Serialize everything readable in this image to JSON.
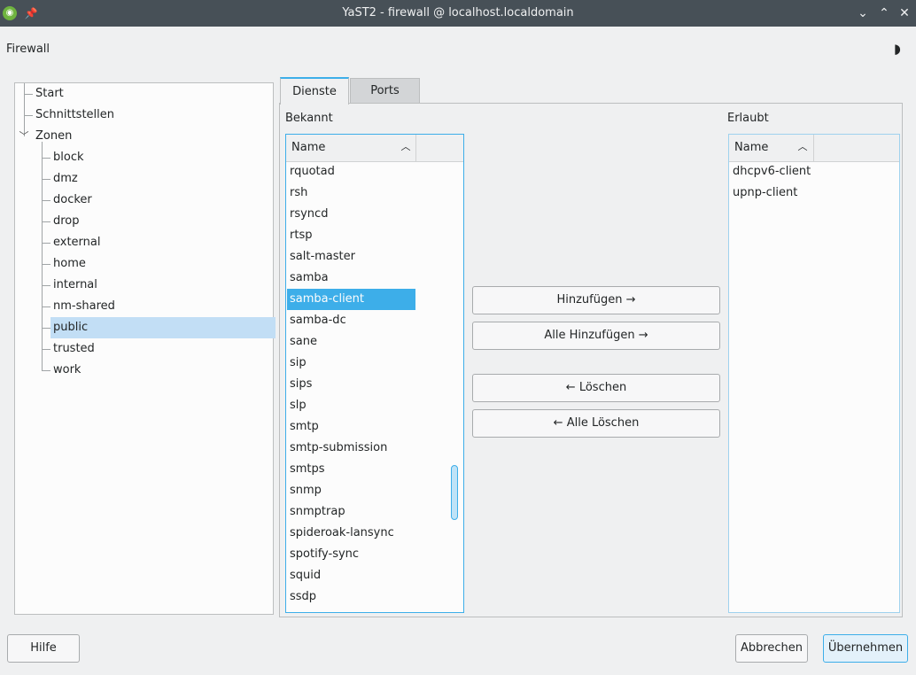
{
  "window": {
    "title": "YaST2 - firewall @ localhost.localdomain"
  },
  "header": {
    "title": "Firewall"
  },
  "tree": {
    "items": [
      {
        "label": "Start"
      },
      {
        "label": "Schnittstellen"
      },
      {
        "label": "Zonen"
      }
    ],
    "zones": [
      "block",
      "dmz",
      "docker",
      "drop",
      "external",
      "home",
      "internal",
      "nm-shared",
      "public",
      "trusted",
      "work"
    ],
    "selected_zone": "public"
  },
  "tabs": [
    {
      "label": "Dienste",
      "active": true
    },
    {
      "label": "Ports",
      "active": false
    }
  ],
  "known": {
    "label": "Bekannt",
    "column": "Name",
    "items": [
      "rquotad",
      "rsh",
      "rsyncd",
      "rtsp",
      "salt-master",
      "samba",
      "samba-client",
      "samba-dc",
      "sane",
      "sip",
      "sips",
      "slp",
      "smtp",
      "smtp-submission",
      "smtps",
      "snmp",
      "snmptrap",
      "spideroak-lansync",
      "spotify-sync",
      "squid",
      "ssdp"
    ],
    "selected": "samba-client"
  },
  "allowed": {
    "label": "Erlaubt",
    "column": "Name",
    "items": [
      "dhcpv6-client",
      "upnp-client"
    ]
  },
  "actions": {
    "add": "Hinzufügen →",
    "add_all": "Alle Hinzufügen →",
    "remove": "← Löschen",
    "remove_all": "← Alle Löschen"
  },
  "footer": {
    "help": "Hilfe",
    "cancel": "Abbrechen",
    "apply": "Übernehmen"
  },
  "colors": {
    "accent": "#3daee9",
    "titlebar": "#475057",
    "selection_light": "#c2def5"
  }
}
